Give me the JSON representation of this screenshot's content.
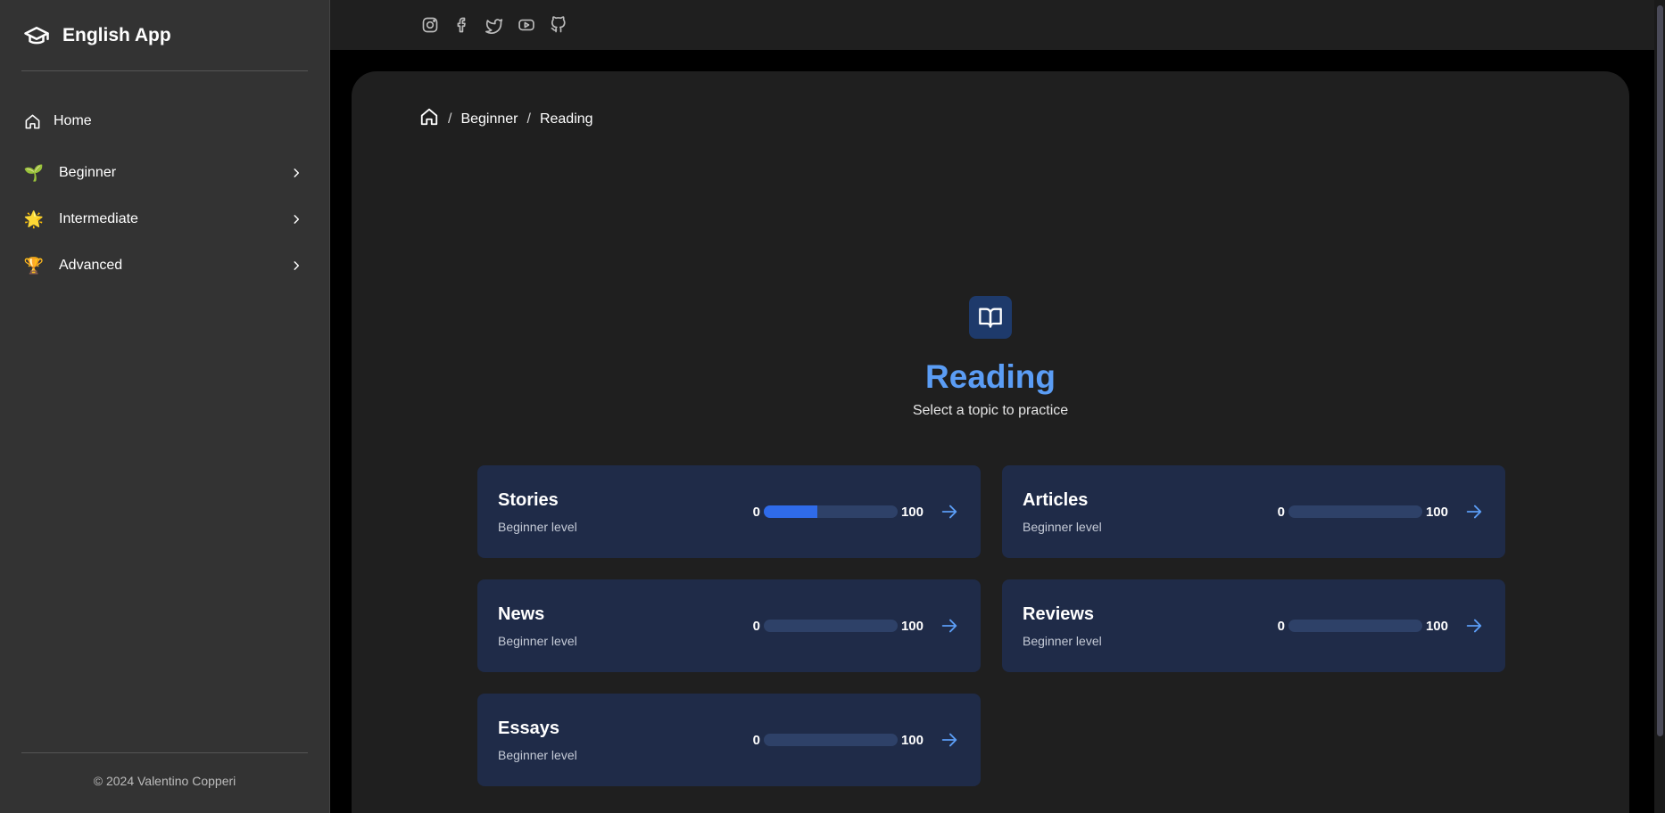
{
  "sidebar": {
    "brand": "English App",
    "items": [
      {
        "label": "Home",
        "icon": "home-icon"
      },
      {
        "label": "Beginner",
        "icon": "🌱"
      },
      {
        "label": "Intermediate",
        "icon": "🌟"
      },
      {
        "label": "Advanced",
        "icon": "🏆"
      }
    ],
    "footer": "© 2024 Valentino Copperi"
  },
  "topbar": {
    "icons": [
      "instagram-icon",
      "facebook-icon",
      "twitter-icon",
      "youtube-icon",
      "github-icon"
    ]
  },
  "breadcrumb": {
    "items": [
      "Beginner",
      "Reading"
    ],
    "separator": "/"
  },
  "hero": {
    "icon": "book-open-icon",
    "title": "Reading",
    "subtitle": "Select a topic to practice"
  },
  "cards": [
    {
      "title": "Stories",
      "subtitle": "Beginner level",
      "min": "0",
      "max": "100",
      "progress": 40
    },
    {
      "title": "Articles",
      "subtitle": "Beginner level",
      "min": "0",
      "max": "100",
      "progress": 0
    },
    {
      "title": "News",
      "subtitle": "Beginner level",
      "min": "0",
      "max": "100",
      "progress": 0
    },
    {
      "title": "Reviews",
      "subtitle": "Beginner level",
      "min": "0",
      "max": "100",
      "progress": 0
    },
    {
      "title": "Essays",
      "subtitle": "Beginner level",
      "min": "0",
      "max": "100",
      "progress": 0
    }
  ],
  "colors": {
    "accent": "#5b9df5",
    "card_bg": "#1f2b48",
    "progress_fill": "#2f6bea",
    "progress_track": "#2e4168"
  }
}
